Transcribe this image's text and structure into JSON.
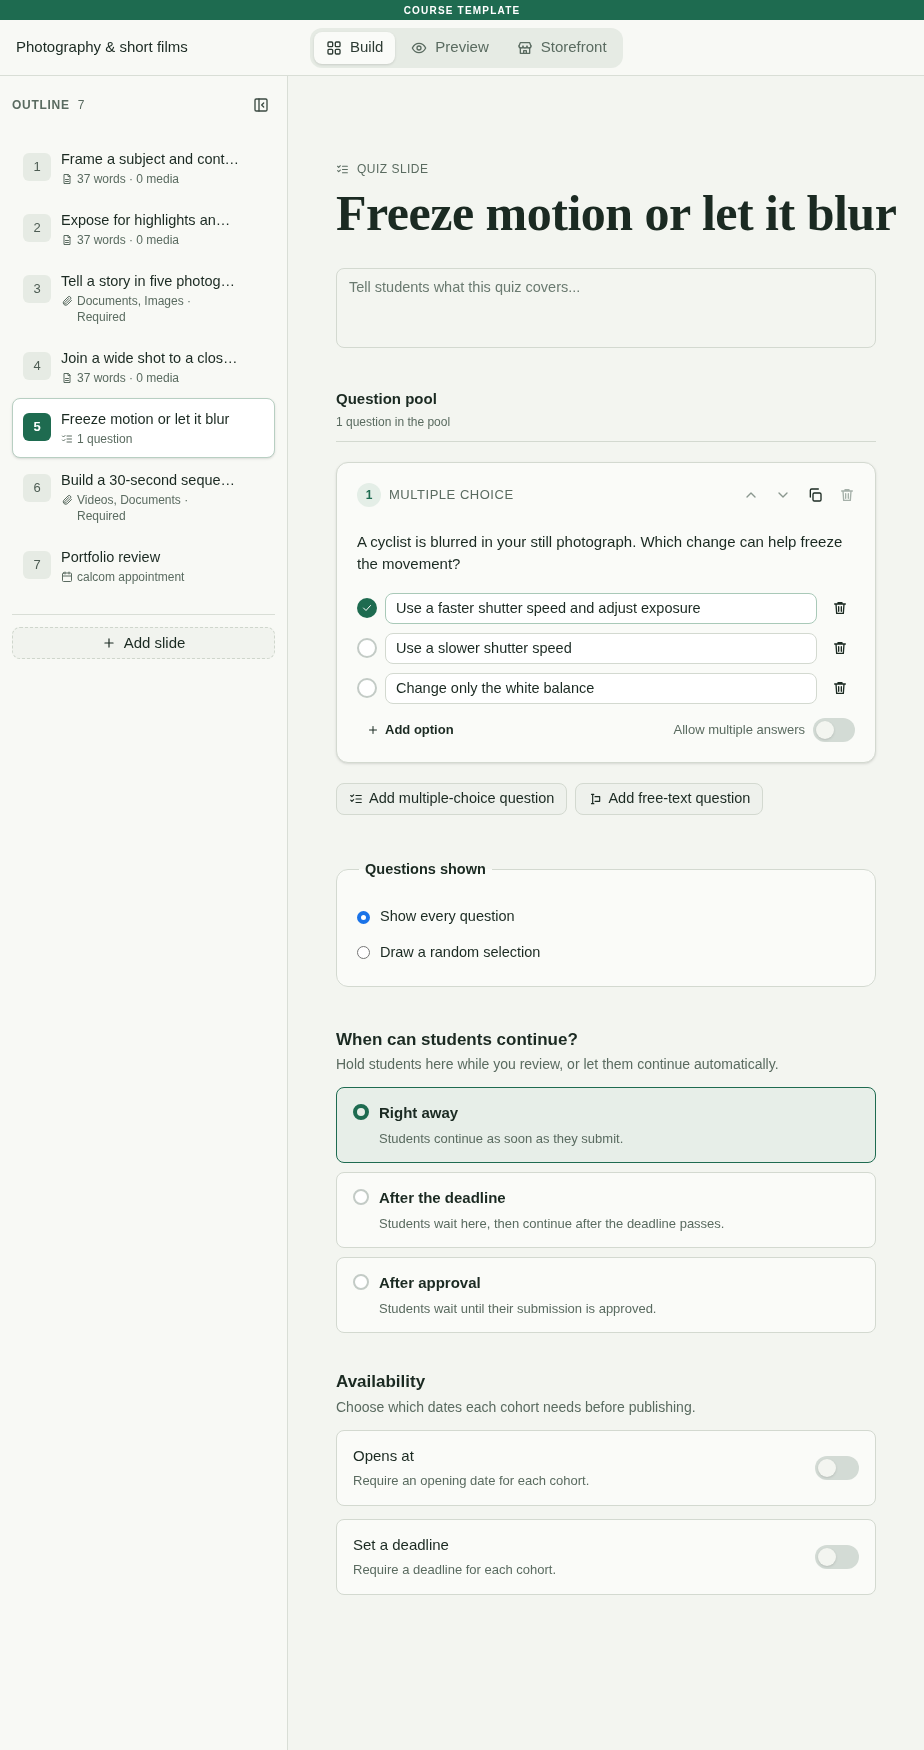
{
  "banner": "COURSE TEMPLATE",
  "header": {
    "course_title": "Photography & short films",
    "tabs": [
      {
        "label": "Build",
        "selected": true
      },
      {
        "label": "Preview",
        "selected": false
      },
      {
        "label": "Storefront",
        "selected": false
      }
    ]
  },
  "sidebar": {
    "heading": "OUTLINE",
    "count": "7",
    "items": [
      {
        "number": "1",
        "title": "Frame a subject and cont…",
        "meta": "37 words · 0 media",
        "kind": "text",
        "selected": false
      },
      {
        "number": "2",
        "title": "Expose for highlights an…",
        "meta": "37 words · 0 media",
        "kind": "text",
        "selected": false
      },
      {
        "number": "3",
        "title": "Tell a story in five photog…",
        "meta": "Documents, Images · Required",
        "kind": "upload",
        "selected": false
      },
      {
        "number": "4",
        "title": "Join a wide shot to a clos…",
        "meta": "37 words · 0 media",
        "kind": "text",
        "selected": false
      },
      {
        "number": "5",
        "title": "Freeze motion or let it blur",
        "meta": "1 question",
        "kind": "quiz",
        "selected": true
      },
      {
        "number": "6",
        "title": "Build a 30-second seque…",
        "meta": "Videos, Documents · Required",
        "kind": "upload",
        "selected": false
      },
      {
        "number": "7",
        "title": "Portfolio review",
        "meta": "calcom appointment",
        "kind": "calendar",
        "selected": false
      }
    ],
    "add_button": "Add slide"
  },
  "main": {
    "eyebrow": "QUIZ SLIDE",
    "title": "Freeze motion or let it blur",
    "description": {
      "placeholder": "Tell students what this quiz covers..."
    },
    "pool": {
      "heading": "Question pool",
      "subheading": "1 question in the pool"
    },
    "questions": [
      {
        "number": "1",
        "type_label": "MULTIPLE CHOICE",
        "prompt": "A cyclist is blurred in your still photograph. Which change can help freeze the movement?",
        "options": [
          {
            "text": "Use a faster shutter speed and adjust exposure",
            "checked": true
          },
          {
            "text": "Use a slower shutter speed",
            "checked": false
          },
          {
            "text": "Change only the white balance",
            "checked": false
          }
        ],
        "add_option": "Add option",
        "multiple_label": "Allow multiple answers",
        "multiple_on": false
      }
    ],
    "add_buttons": [
      {
        "label": "Add multiple-choice question"
      },
      {
        "label": "Add free-text question"
      }
    ],
    "shown": {
      "legend": "Questions shown",
      "options": [
        {
          "label": "Show every question",
          "selected": true
        },
        {
          "label": "Draw a random selection",
          "selected": false
        }
      ]
    },
    "continue": {
      "heading": "When can students continue?",
      "subheading": "Hold students here while you review, or let them continue automatically.",
      "options": [
        {
          "title": "Right away",
          "description": "Students continue as soon as they submit.",
          "selected": true
        },
        {
          "title": "After the deadline",
          "description": "Students wait here, then continue after the deadline passes.",
          "selected": false
        },
        {
          "title": "After approval",
          "description": "Students wait until their submission is approved.",
          "selected": false
        }
      ]
    },
    "availability": {
      "heading": "Availability",
      "subheading": "Choose which dates each cohort needs before publishing.",
      "items": [
        {
          "title": "Opens at",
          "description": "Require an opening date for each cohort.",
          "on": false
        },
        {
          "title": "Set a deadline",
          "description": "Require a deadline for each cohort.",
          "on": false
        }
      ]
    }
  }
}
